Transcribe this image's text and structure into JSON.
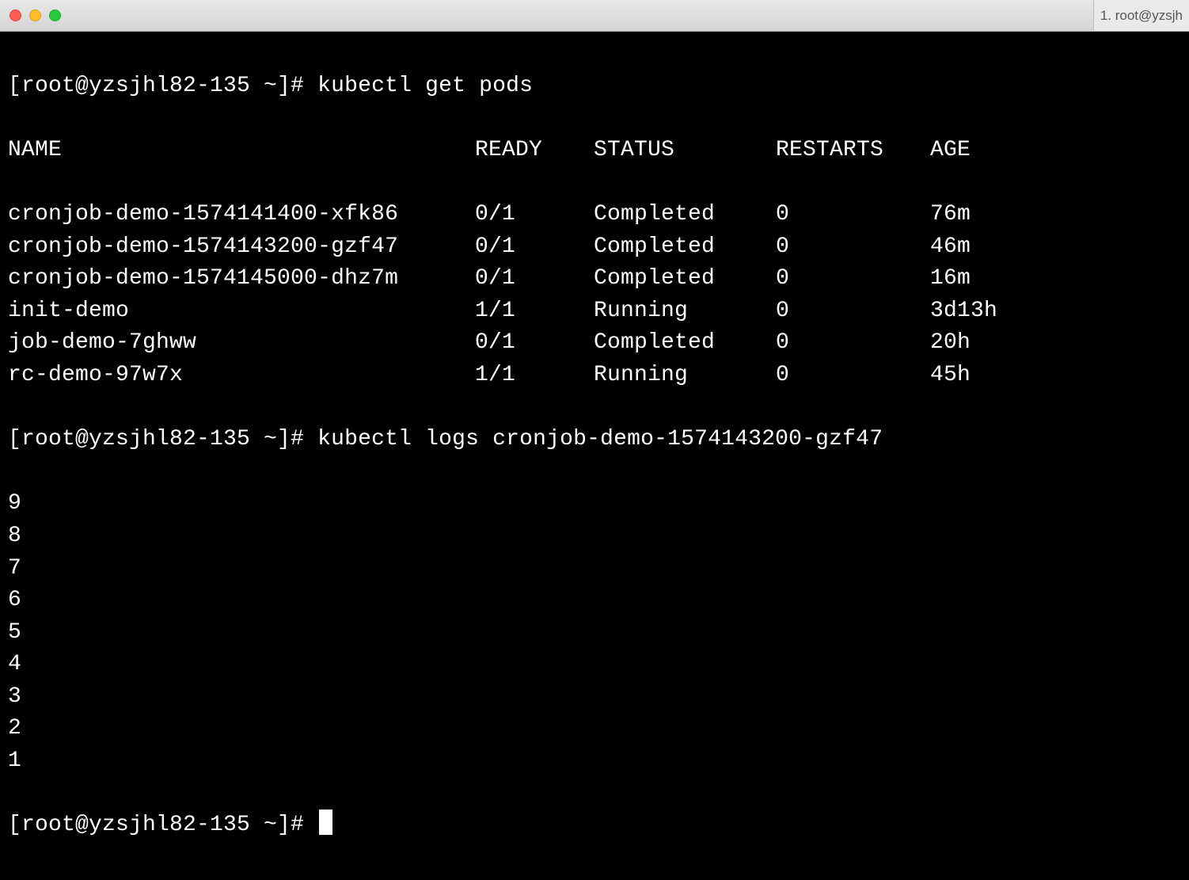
{
  "titlebar": {
    "tab_label": "1. root@yzsjh"
  },
  "prompt": "[root@yzsjhl82-135 ~]# ",
  "commands": {
    "get_pods": "kubectl get pods",
    "logs": "kubectl logs cronjob-demo-1574143200-gzf47"
  },
  "table": {
    "headers": {
      "name": "NAME",
      "ready": "READY",
      "status": "STATUS",
      "restarts": "RESTARTS",
      "age": "AGE"
    },
    "rows": [
      {
        "name": "cronjob-demo-1574141400-xfk86",
        "ready": "0/1",
        "status": "Completed",
        "restarts": "0",
        "age": "76m"
      },
      {
        "name": "cronjob-demo-1574143200-gzf47",
        "ready": "0/1",
        "status": "Completed",
        "restarts": "0",
        "age": "46m"
      },
      {
        "name": "cronjob-demo-1574145000-dhz7m",
        "ready": "0/1",
        "status": "Completed",
        "restarts": "0",
        "age": "16m"
      },
      {
        "name": "init-demo",
        "ready": "1/1",
        "status": "Running",
        "restarts": "0",
        "age": "3d13h"
      },
      {
        "name": "job-demo-7ghww",
        "ready": "0/1",
        "status": "Completed",
        "restarts": "0",
        "age": "20h"
      },
      {
        "name": "rc-demo-97w7x",
        "ready": "1/1",
        "status": "Running",
        "restarts": "0",
        "age": "45h"
      }
    ]
  },
  "log_output": [
    "9",
    "8",
    "7",
    "6",
    "5",
    "4",
    "3",
    "2",
    "1"
  ]
}
